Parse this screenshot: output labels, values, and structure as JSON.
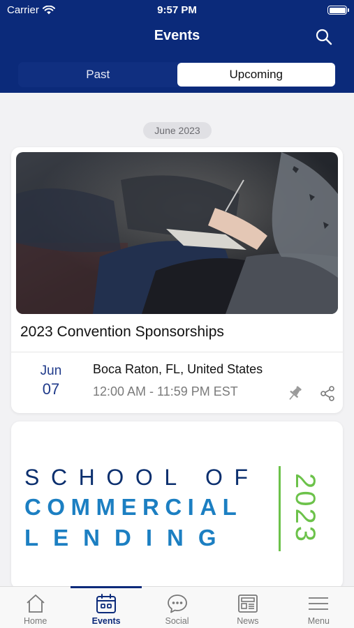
{
  "status_bar": {
    "carrier": "Carrier",
    "time": "9:57 PM"
  },
  "header": {
    "title": "Events"
  },
  "segments": [
    {
      "label": "Past",
      "active": false
    },
    {
      "label": "Upcoming",
      "active": true
    }
  ],
  "month_label": "June 2023",
  "events": [
    {
      "title": "2023 Convention Sponsorships",
      "date_month": "Jun",
      "date_day": "07",
      "location": "Boca Raton, FL, United States",
      "time": "12:00 AM - 11:59 PM EST"
    }
  ],
  "promo": {
    "line1": "SCHOOL OF",
    "line2": "COMMERCIAL",
    "line3": "LENDING",
    "year": "2023"
  },
  "tabs": [
    {
      "label": "Home",
      "icon": "home-icon"
    },
    {
      "label": "Events",
      "icon": "calendar-icon"
    },
    {
      "label": "Social",
      "icon": "chat-bubble-icon"
    },
    {
      "label": "News",
      "icon": "newspaper-icon"
    },
    {
      "label": "Menu",
      "icon": "hamburger-icon"
    }
  ],
  "colors": {
    "brand": "#0b2a7a",
    "accent_green": "#6cc24a",
    "accent_blue": "#1c7fc2"
  }
}
